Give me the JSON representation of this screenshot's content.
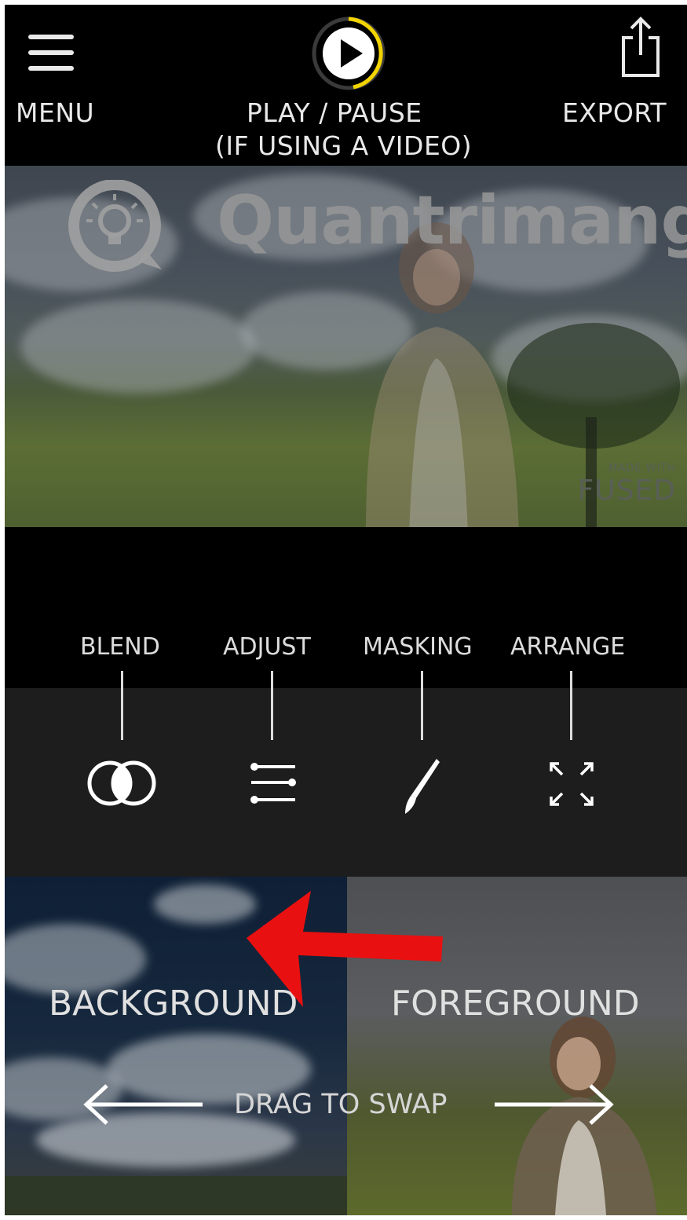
{
  "topbar": {
    "menu_label": "MENU",
    "play_label_line1": "PLAY / PAUSE",
    "play_label_line2": "(IF USING A VIDEO)",
    "export_label": "EXPORT",
    "accent_color": "#f2d400"
  },
  "preview": {
    "watermark_text": "Quantrimang",
    "made_with_small": "MADE WITH",
    "made_with_big": "FUSED"
  },
  "tools": [
    {
      "label": "BLEND",
      "icon": "blend-icon"
    },
    {
      "label": "ADJUST",
      "icon": "sliders-icon"
    },
    {
      "label": "MASKING",
      "icon": "brush-icon"
    },
    {
      "label": "ARRANGE",
      "icon": "expand-arrows-icon"
    }
  ],
  "swap": {
    "background_label": "BACKGROUND",
    "foreground_label": "FOREGROUND",
    "drag_label": "DRAG TO SWAP",
    "annotation_arrow_color": "#e81010"
  }
}
